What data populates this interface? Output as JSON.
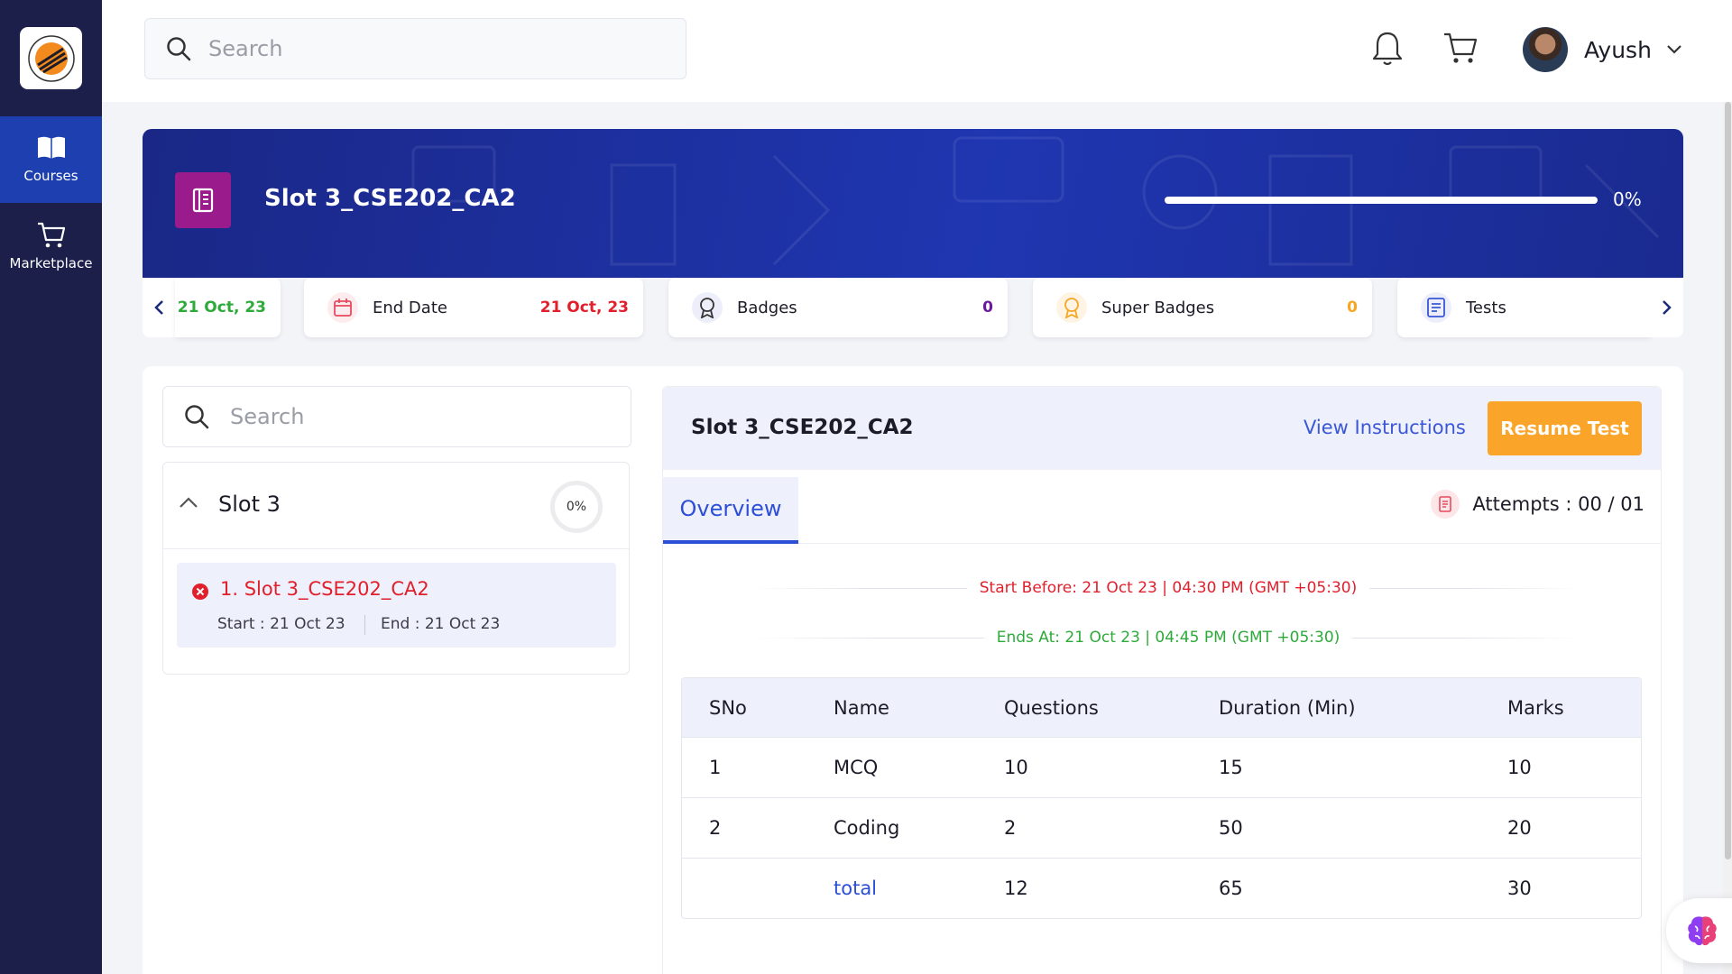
{
  "sidebar": {
    "items": [
      {
        "label": "Courses",
        "icon": "book-icon",
        "active": true
      },
      {
        "label": "Marketplace",
        "icon": "cart-icon",
        "active": false
      }
    ]
  },
  "topbar": {
    "search_placeholder": "Search",
    "user_name": "Ayush"
  },
  "banner": {
    "title": "Slot 3_CSE202_CA2",
    "progress_percent": "0%",
    "progress_value": 0
  },
  "cards": {
    "start_date_value": "21 Oct, 23",
    "end_date_label": "End Date",
    "end_date_value": "21 Oct, 23",
    "badges_label": "Badges",
    "badges_value": "0",
    "super_badges_label": "Super Badges",
    "super_badges_value": "0",
    "tests_label": "Tests"
  },
  "left_panel": {
    "search_placeholder": "Search",
    "slot_title": "Slot 3",
    "slot_progress": "0%",
    "item": {
      "title": "1. Slot 3_CSE202_CA2",
      "start": "Start : 21 Oct 23",
      "end": "End : 21 Oct 23"
    }
  },
  "test_panel": {
    "title": "Slot 3_CSE202_CA2",
    "view_instructions": "View Instructions",
    "resume_button": "Resume Test",
    "tab_overview": "Overview",
    "attempts": "Attempts : 00 / 01",
    "start_before": "Start Before: 21 Oct 23 | 04:30 PM (GMT +05:30)",
    "ends_at": "Ends At: 21 Oct 23 | 04:45 PM (GMT +05:30)"
  },
  "table": {
    "headers": [
      "SNo",
      "Name",
      "Questions",
      "Duration (Min)",
      "Marks"
    ],
    "rows": [
      [
        "1",
        "MCQ",
        "10",
        "15",
        "10"
      ],
      [
        "2",
        "Coding",
        "2",
        "50",
        "20"
      ]
    ],
    "total": [
      "",
      "total",
      "12",
      "65",
      "30"
    ]
  },
  "colors": {
    "sidebar_bg": "#1c1f4a",
    "accent_blue": "#2d4fd6",
    "resume_orange": "#fba42a",
    "start_green": "#2eaa3a",
    "end_red": "#e0202c",
    "badge_purple": "#6a1b9a",
    "super_badge_orange": "#f5a623"
  }
}
